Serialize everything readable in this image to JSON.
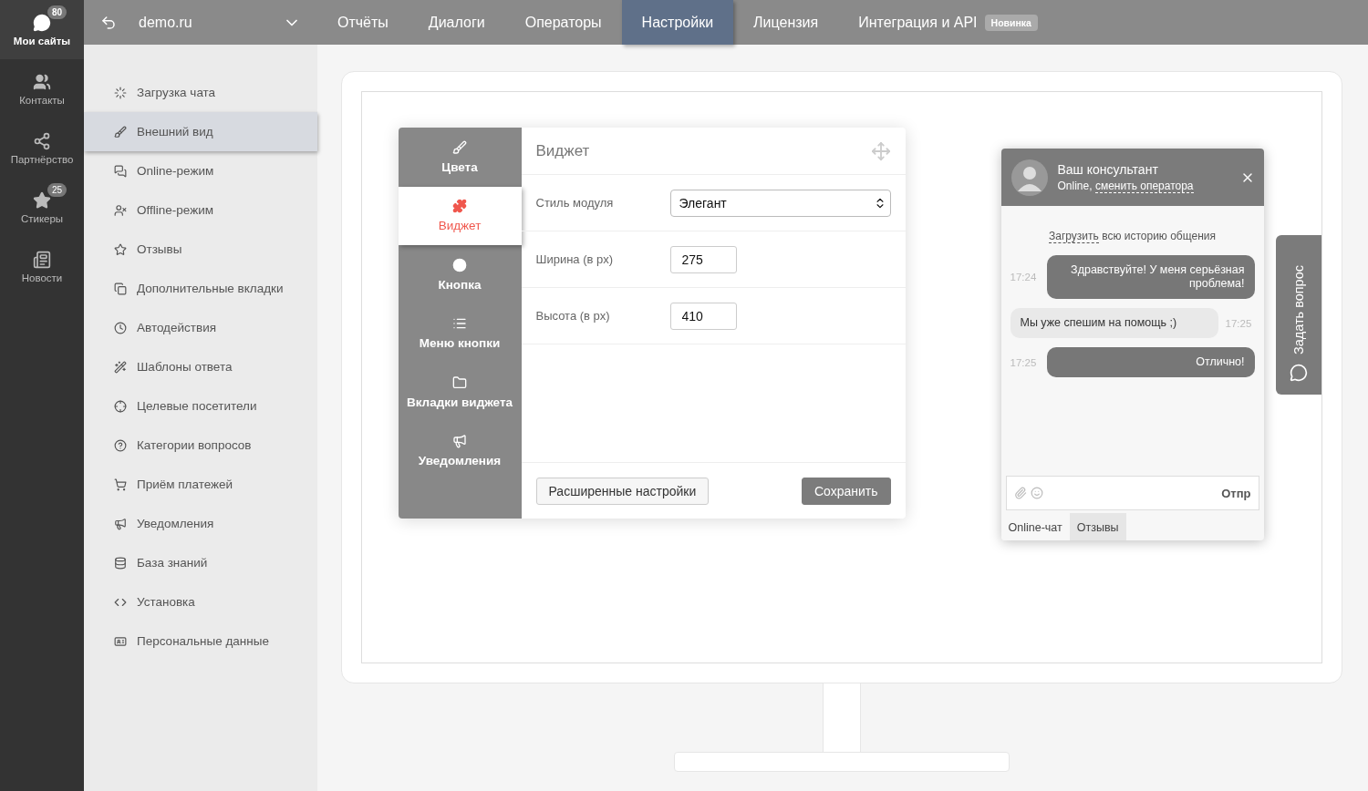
{
  "rail": [
    {
      "label": "Мои сайты",
      "badge": "80",
      "selected": true
    },
    {
      "label": "Контакты",
      "selected": false
    },
    {
      "label": "Партнёрство",
      "selected": false
    },
    {
      "label": "Стикеры",
      "badge": "25",
      "selected": false
    },
    {
      "label": "Новости",
      "selected": false
    }
  ],
  "topbar": {
    "site": "demo.ru",
    "nav": [
      {
        "label": "Отчёты",
        "selected": false
      },
      {
        "label": "Диалоги",
        "selected": false
      },
      {
        "label": "Операторы",
        "selected": false
      },
      {
        "label": "Настройки",
        "selected": true
      },
      {
        "label": "Лицензия",
        "selected": false
      },
      {
        "label": "Интеграция и API",
        "selected": false,
        "badge": "Новинка"
      }
    ]
  },
  "sidebar": {
    "items": [
      {
        "label": "Загрузка чата",
        "selected": false
      },
      {
        "label": "Внешний вид",
        "selected": true
      },
      {
        "label": "Online-режим",
        "selected": false
      },
      {
        "label": "Offline-режим",
        "selected": false
      },
      {
        "label": "Отзывы",
        "selected": false
      },
      {
        "label": "Дополнительные вкладки",
        "selected": false
      },
      {
        "label": "Автодействия",
        "selected": false
      },
      {
        "label": "Шаблоны ответа",
        "selected": false
      },
      {
        "label": "Целевые посетители",
        "selected": false
      },
      {
        "label": "Категории вопросов",
        "selected": false
      },
      {
        "label": "Приём платежей",
        "selected": false
      },
      {
        "label": "Уведомления",
        "selected": false
      },
      {
        "label": "База знаний",
        "selected": false
      },
      {
        "label": "Установка",
        "selected": false
      },
      {
        "label": "Персональные данные",
        "selected": false
      }
    ]
  },
  "editor": {
    "tabs": [
      {
        "label": "Цвета",
        "selected": false
      },
      {
        "label": "Виджет",
        "selected": true
      },
      {
        "label": "Кнопка",
        "selected": false
      },
      {
        "label": "Меню кнопки",
        "selected": false
      },
      {
        "label": "Вкладки виджета",
        "selected": false
      },
      {
        "label": "Уведомления",
        "selected": false
      }
    ],
    "title": "Виджет",
    "fields": [
      {
        "kind": "select",
        "label": "Стиль модуля",
        "value": "Элегант"
      },
      {
        "kind": "input",
        "label": "Ширина (в px)",
        "value": "275"
      },
      {
        "kind": "input",
        "label": "Высота (в px)",
        "value": "410"
      }
    ],
    "buttons": [
      {
        "kind": "secondary",
        "label": "Расширенные настройки"
      },
      {
        "kind": "primary",
        "label": "Сохранить"
      }
    ]
  },
  "chat": {
    "title": "Ваш консультант",
    "status": "Online,",
    "change_link": "сменить оператора",
    "history_link": "Загрузить",
    "history_text": "всю историю общения",
    "messages": [
      {
        "kind": "visitor",
        "time": "17:24",
        "text": "Здравствуйте! У меня серьёзная проблема!"
      },
      {
        "kind": "operator",
        "time": "17:25",
        "text": "Мы уже спешим на помощь ;)"
      },
      {
        "kind": "visitor",
        "time": "17:25",
        "text": "Отлично!"
      }
    ],
    "send": "Отпр",
    "tabs": [
      {
        "label": "Online-чат",
        "selected": true
      },
      {
        "label": "Отзывы",
        "selected": false
      }
    ]
  },
  "ask_tab": "Задать вопрос"
}
